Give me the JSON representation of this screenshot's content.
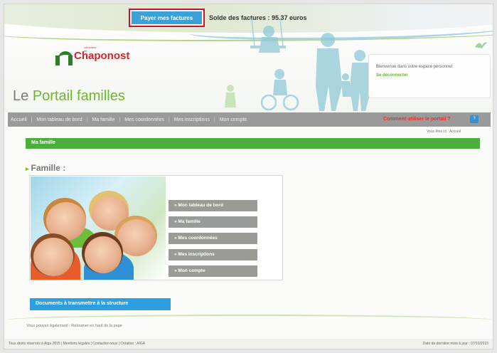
{
  "top": {
    "pay_button": "Payer mes factures",
    "balance": "Solde des factures : 95.37 euros"
  },
  "logo": {
    "small_text": "commune de",
    "name": "Chaponost"
  },
  "portal_title": {
    "prefix": "Le",
    "main": "Portail familles"
  },
  "welcome": {
    "message": "Bienvenue dans votre espace personnel",
    "logout": "Se déconnecter"
  },
  "nav": {
    "items": [
      "Accueil",
      "Mon tableau de bord",
      "Ma famille",
      "Mes coordonnées",
      "Mes inscriptions",
      "Mon compte"
    ],
    "help": "Comment utiliser le portail ?"
  },
  "breadcrumb": "Vous êtes ici : Accueil",
  "section_bar": "Ma famille",
  "famille_title": "Famille :",
  "menu": [
    "» Mon tableau de bord",
    "» Ma famille",
    "» Mes coordonnées",
    "» Mes inscriptions",
    "» Mon compte"
  ],
  "docs_button": "Documents à transmettre à la structure",
  "back_links": "Vous pouvez également : Retourner en haut de la page",
  "footer": {
    "left": "Tous droits réservés à Aiga 2015 | Mentions légales | Contactez-nous | Création : AIGA",
    "right": "Date de dernière mise à jour : 07/10/2015"
  },
  "colors": {
    "brand_green": "#6fb531",
    "section_green": "#4cae3b",
    "pay_blue": "#3aa2d8",
    "docs_blue": "#2d9fe0",
    "nav_gray": "#9a9a9a",
    "highlight_red": "#c8102e"
  }
}
